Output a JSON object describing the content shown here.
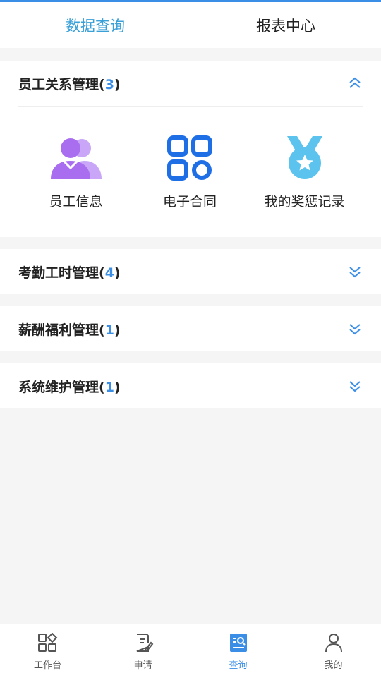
{
  "tabs": [
    {
      "label": "数据查询",
      "active": true
    },
    {
      "label": "报表中心",
      "active": false
    }
  ],
  "sections": [
    {
      "title": "员工关系管理",
      "count": "3",
      "expanded": true,
      "items": [
        {
          "label": "员工信息",
          "icon": "users-icon"
        },
        {
          "label": "电子合同",
          "icon": "grid-circles-icon"
        },
        {
          "label": "我的奖惩记录",
          "icon": "medal-icon"
        }
      ]
    },
    {
      "title": "考勤工时管理",
      "count": "4",
      "expanded": false
    },
    {
      "title": "薪酬福利管理",
      "count": "1",
      "expanded": false
    },
    {
      "title": "系统维护管理",
      "count": "1",
      "expanded": false
    }
  ],
  "bottom_nav": [
    {
      "label": "工作台",
      "icon": "workbench-icon",
      "active": false
    },
    {
      "label": "申请",
      "icon": "apply-icon",
      "active": false
    },
    {
      "label": "查询",
      "icon": "query-icon",
      "active": true
    },
    {
      "label": "我的",
      "icon": "profile-icon",
      "active": false
    }
  ],
  "colors": {
    "accent": "#3a8ee6",
    "active_tab": "#3aa0d8",
    "purple": "#a96ef0",
    "blue": "#1e6fe6",
    "sky": "#5cc3ee"
  }
}
